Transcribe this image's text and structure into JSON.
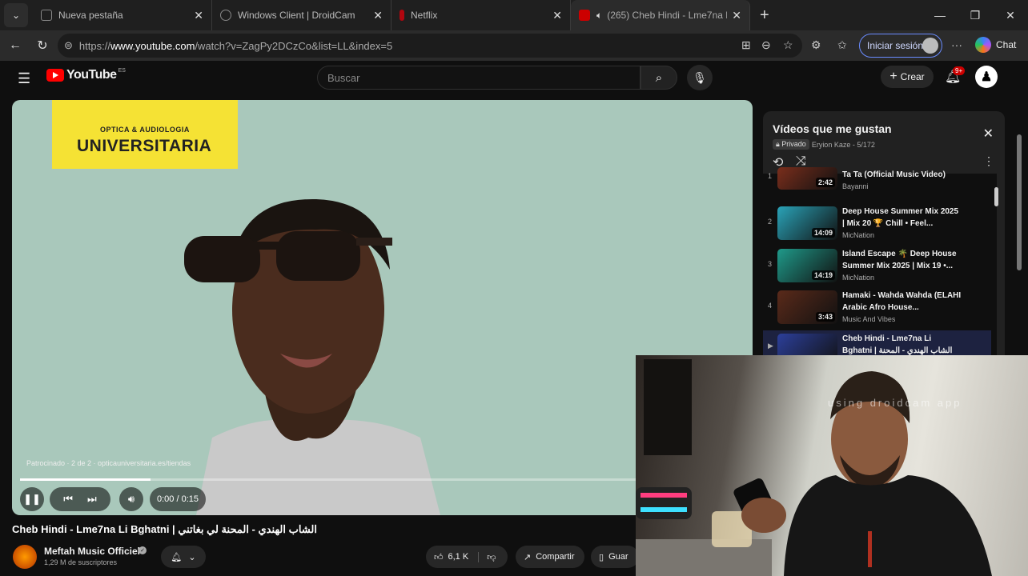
{
  "browser": {
    "tabs": [
      {
        "title": "Nueva pestaña"
      },
      {
        "title": "Windows Client | DroidCam"
      },
      {
        "title": "Netflix"
      },
      {
        "title": "(265) Cheb Hindi - Lme7na Li"
      }
    ],
    "url_prefix": "https://",
    "url_host": "www.youtube.com",
    "url_path": "/watch?v=ZagPy2DCzCo&list=LL&index=5",
    "signin_label": "Iniciar sesión",
    "chat_label": "Chat"
  },
  "youtube": {
    "logo_text": "YouTube",
    "logo_region": "ES",
    "search_placeholder": "Buscar",
    "create_label": "Crear",
    "notif_badge": "9+"
  },
  "player": {
    "ad_line1": "OPTICA & AUDIOLOGIA",
    "ad_line2": "UNIVERSITARIA",
    "sponsor_text": "Patrocinado · 2 de 2 · opticauniversitaria.es/tiendas",
    "time": "0:00 / 0:15",
    "progress": 0.18
  },
  "video": {
    "title": "Cheb Hindi - Lme7na Li Bghatni | الشاب الهندي - المحنة لي بغاتني",
    "channel": "Meftah Music Officiel",
    "subscribers": "1,29 M de suscriptores",
    "likes": "6,1 K",
    "share_label": "Compartir",
    "save_label": "Guar"
  },
  "playlist": {
    "title": "Vídeos que me gustan",
    "privacy": "Privado",
    "owner_meta": "Eryion Kaze - 5/172",
    "items": [
      {
        "index": "1",
        "title": "Ta Ta (Official Music Video)",
        "artist": "Bayanni",
        "duration": "2:42",
        "color": "#7a2e1c"
      },
      {
        "index": "2",
        "title": "Deep House Summer Mix 2025 | Mix 20 🏆 Chill • Feel...",
        "artist": "MicNation",
        "duration": "14:09",
        "color": "#2aa3b8"
      },
      {
        "index": "3",
        "title": "Island Escape 🌴 Deep House Summer Mix 2025 | Mix 19 •...",
        "artist": "MicNation",
        "duration": "14:19",
        "color": "#1f9a8a"
      },
      {
        "index": "4",
        "title": "Hamaki - Wahda Wahda (ELAHI Arabic Afro House...",
        "artist": "Music And Vibes",
        "duration": "3:43",
        "color": "#5a2a1a"
      },
      {
        "index": "▶",
        "title": "Cheb Hindi - Lme7na Li Bghatni | الشاب الهندي - المحنة لي...",
        "artist": "",
        "duration": "",
        "color": "#2c3f9a"
      }
    ]
  },
  "webcam": {
    "watermark": "using droidcam app"
  }
}
